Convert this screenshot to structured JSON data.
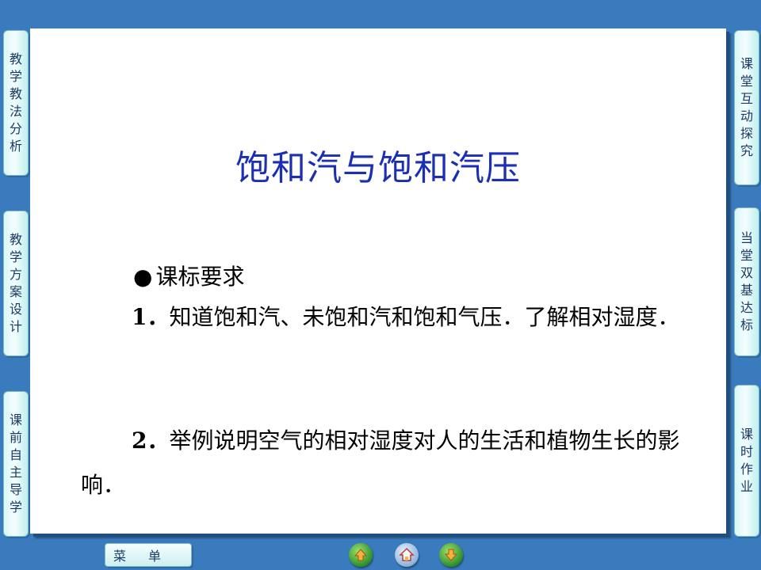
{
  "slide": {
    "title": "饱和汽与饱和汽压",
    "section_heading": "课标要求",
    "items": [
      {
        "number": "1．",
        "text": "知道饱和汽、未饱和汽和饱和气压．了解相对湿度．"
      },
      {
        "number": "2．",
        "text": "举例说明空气的相对湿度对人的生活和植物生长的影响．"
      }
    ]
  },
  "left_tabs": [
    {
      "label": [
        "教",
        "学",
        "教",
        "法",
        "分",
        "析"
      ]
    },
    {
      "label": [
        "教",
        "学",
        "方",
        "案",
        "设",
        "计"
      ]
    },
    {
      "label": [
        "课",
        "前",
        "自",
        "主",
        "导",
        "学"
      ]
    }
  ],
  "right_tabs": [
    {
      "label": [
        "课",
        "堂",
        "互",
        "动",
        "探",
        "究"
      ]
    },
    {
      "label": [
        "当",
        "堂",
        "双",
        "基",
        "达",
        "标"
      ]
    },
    {
      "label": [
        "课",
        "时",
        "作",
        "业"
      ]
    }
  ],
  "bottom_bar": {
    "menu_label": "菜单",
    "prev_icon": "up-arrow-icon",
    "home_icon": "home-icon",
    "next_icon": "down-arrow-icon"
  },
  "colors": {
    "background": "#3a7bbd",
    "title": "#1a2fb4",
    "tab_fill": "#e6fbfb"
  }
}
